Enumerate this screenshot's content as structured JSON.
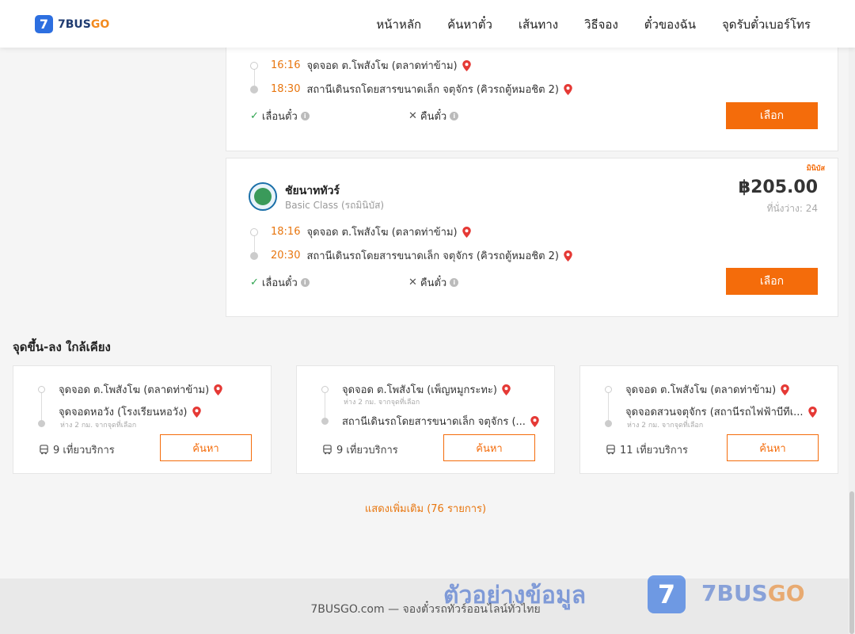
{
  "header": {
    "logo_mark": "7",
    "logo_text_a": "7BUS",
    "logo_text_b": "GO",
    "nav": [
      "หน้าหลัก",
      "ค้นหาตั๋ว",
      "เส้นทาง",
      "วิธีจอง",
      "ตั๋วของฉัน",
      "จุดรับตั๋วเบอร์โทร"
    ]
  },
  "trips": [
    {
      "depart_time": "16:16",
      "depart_place": "จุดจอด ต.โพสังโฆ (ตลาดท่าข้าม)",
      "arrive_time": "18:30",
      "arrive_place": "สถานีเดินรถโดยสารขนาดเล็ก จตุจักร (คิวรถตู้หมอชิต 2)",
      "perk_change": "เลื่อนตั๋ว",
      "perk_refund": "คืนตั๋ว",
      "select_label": "เลือก"
    },
    {
      "ribbon": "มินิบัส",
      "operator": "ชัยนาททัวร์",
      "class": "Basic Class (รถมินิบัส)",
      "price": "฿205.00",
      "seats": "ที่นั่งว่าง: 24",
      "depart_time": "18:16",
      "depart_place": "จุดจอด ต.โพสังโฆ (ตลาดท่าข้าม)",
      "arrive_time": "20:30",
      "arrive_place": "สถานีเดินรถโดยสารขนาดเล็ก จตุจักร (คิวรถตู้หมอชิต 2)",
      "perk_change": "เลื่อนตั๋ว",
      "perk_refund": "คืนตั๋ว",
      "select_label": "เลือก"
    }
  ],
  "nearby": {
    "title": "จุดขึ้น-ลง ใกล้เคียง",
    "cards": [
      {
        "from": "จุดจอด ต.โพสังโฆ (ตลาดท่าข้าม)",
        "from_sub": "",
        "to": "จุดจอดหอวัง (โรงเรียนหอวัง)",
        "to_sub": "ห่าง 2 กม. จากจุดที่เลือก",
        "trips": "9 เที่ยวบริการ",
        "search_label": "ค้นหา"
      },
      {
        "from": "จุดจอด ต.โพสังโฆ (เพ็ญหมูกระทะ)",
        "from_sub": "ห่าง 2 กม. จากจุดที่เลือก",
        "to": "สถานีเดินรถโดยสารขนาดเล็ก จตุจักร (...",
        "to_sub": "",
        "trips": "9 เที่ยวบริการ",
        "search_label": "ค้นหา"
      },
      {
        "from": "จุดจอด ต.โพสังโฆ (ตลาดท่าข้าม)",
        "from_sub": "",
        "to": "จุดจอดสวนจตุจักร (สถานีรถไฟฟ้าบีทีเ...",
        "to_sub": "ห่าง 2 กม. จากจุดที่เลือก",
        "trips": "11 เที่ยวบริการ",
        "search_label": "ค้นหา"
      }
    ]
  },
  "show_more": "แสดงเพิ่มเติม (76 รายการ)",
  "footer": {
    "text": "7BUSGO.com — จองตั๋วรถทัวร์ออนไลน์ทั่วไทย",
    "watermark": "ตัวอย่างข้อมูล",
    "wm_mark": "7",
    "wm_text_a": "7BUS",
    "wm_text_b": "GO"
  },
  "colors": {
    "accent": "#f46c0b",
    "time": "#e8760f",
    "brand_blue": "#2d6fe0",
    "check": "#2ea44f"
  }
}
